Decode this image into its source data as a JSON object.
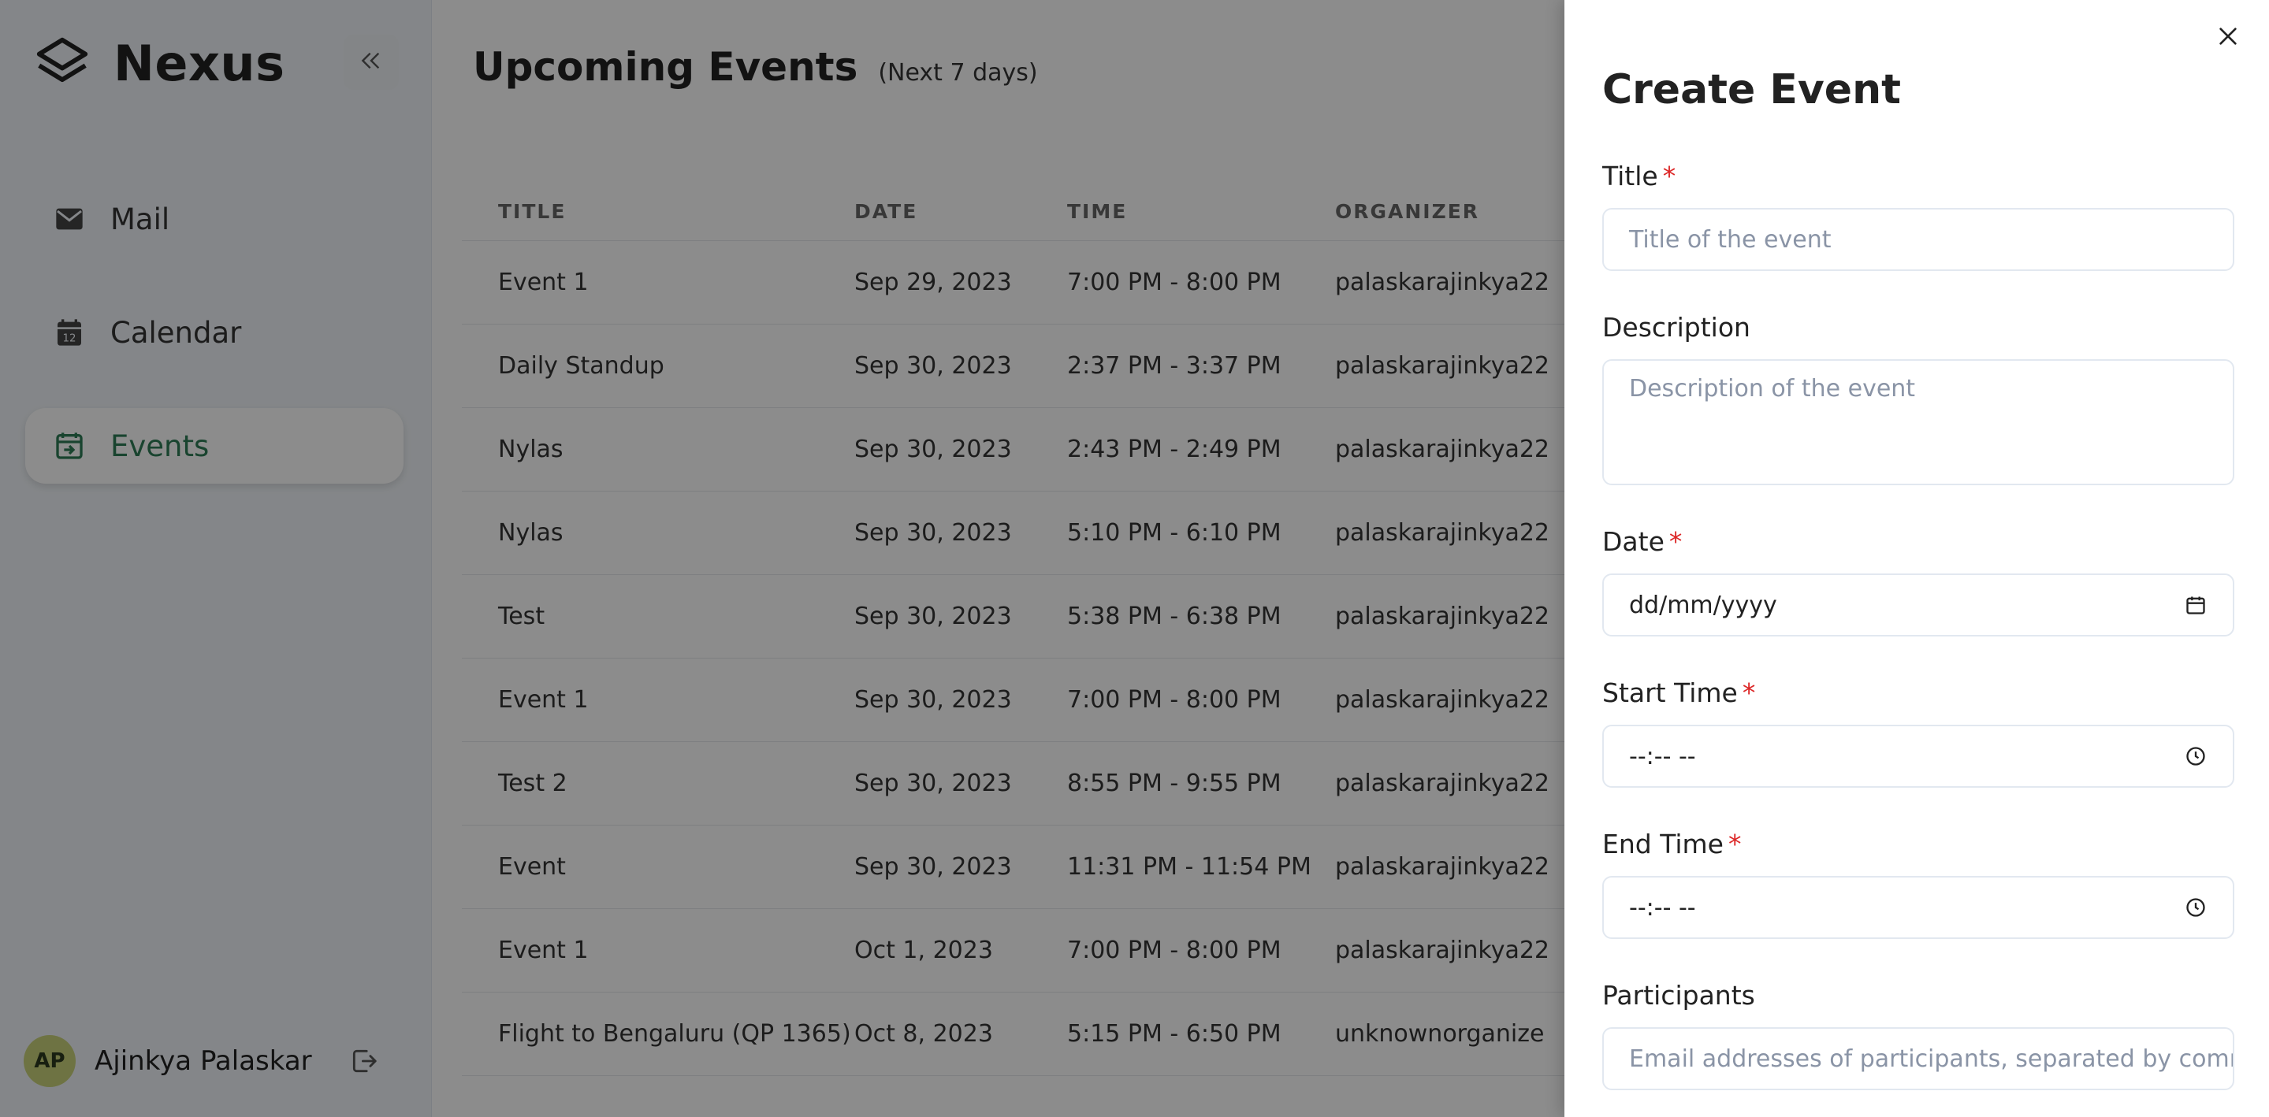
{
  "app": {
    "name": "Nexus"
  },
  "sidebar": {
    "items": [
      {
        "label": "Mail",
        "icon": "mail-icon"
      },
      {
        "label": "Calendar",
        "icon": "calendar-icon"
      },
      {
        "label": "Events",
        "icon": "events-icon",
        "active": true
      }
    ],
    "user": {
      "initials": "AP",
      "name": "Ajinkya Palaskar"
    },
    "accent_color": "#2f7d57"
  },
  "main": {
    "title": "Upcoming Events",
    "subtitle": "(Next 7 days)",
    "table": {
      "headers": [
        "TITLE",
        "DATE",
        "TIME",
        "ORGANIZER"
      ],
      "rows": [
        [
          "Event 1",
          "Sep 29, 2023",
          "7:00 PM - 8:00 PM",
          "palaskarajinkya22"
        ],
        [
          "Daily Standup",
          "Sep 30, 2023",
          "2:37 PM - 3:37 PM",
          "palaskarajinkya22"
        ],
        [
          "Nylas",
          "Sep 30, 2023",
          "2:43 PM - 2:49 PM",
          "palaskarajinkya22"
        ],
        [
          "Nylas",
          "Sep 30, 2023",
          "5:10 PM - 6:10 PM",
          "palaskarajinkya22"
        ],
        [
          "Test",
          "Sep 30, 2023",
          "5:38 PM - 6:38 PM",
          "palaskarajinkya22"
        ],
        [
          "Event 1",
          "Sep 30, 2023",
          "7:00 PM - 8:00 PM",
          "palaskarajinkya22"
        ],
        [
          "Test 2",
          "Sep 30, 2023",
          "8:55 PM - 9:55 PM",
          "palaskarajinkya22"
        ],
        [
          "Event",
          "Sep 30, 2023",
          "11:31 PM - 11:54 PM",
          "palaskarajinkya22"
        ],
        [
          "Event 1",
          "Oct 1, 2023",
          "7:00 PM - 8:00 PM",
          "palaskarajinkya22"
        ],
        [
          "Flight to Bengaluru (QP 1365)",
          "Oct 8, 2023",
          "5:15 PM - 6:50 PM",
          "unknownorganize"
        ]
      ]
    }
  },
  "drawer": {
    "title": "Create Event",
    "fields": {
      "title": {
        "label": "Title",
        "required_mark": "*",
        "placeholder": "Title of the event"
      },
      "description": {
        "label": "Description",
        "placeholder": "Description of the event"
      },
      "date": {
        "label": "Date",
        "required_mark": "*",
        "value": "dd/mm/yyyy"
      },
      "start_time": {
        "label": "Start Time",
        "required_mark": "*",
        "value": "--:-- --"
      },
      "end_time": {
        "label": "End Time",
        "required_mark": "*",
        "value": "--:-- --"
      },
      "participants": {
        "label": "Participants",
        "placeholder": "Email addresses of participants, separated by comm"
      }
    },
    "required_color": "#dc2626"
  }
}
